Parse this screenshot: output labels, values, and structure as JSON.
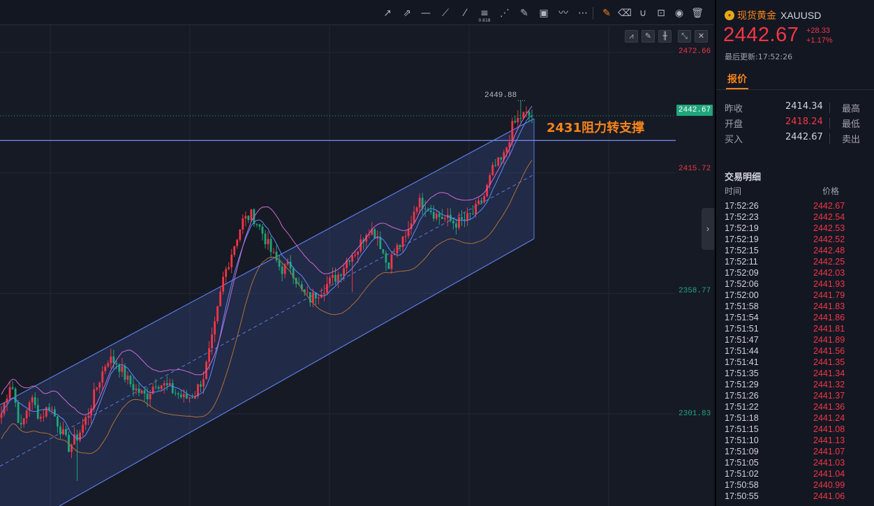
{
  "toolbar": {
    "tools": [
      "ray-icon",
      "arrow-icon",
      "horizontal-line-icon",
      "trend-line-icon",
      "extended-line-icon",
      "fib-retracement-icon",
      "fib-fan-icon",
      "brush-icon",
      "image-icon",
      "path-icon",
      "more-icon",
      "edit-active-icon",
      "eraser-icon",
      "magnet-icon",
      "lock-icon",
      "eye-icon",
      "trash-icon"
    ],
    "fib_label": "0.618"
  },
  "chart_controls": [
    "indicator-icon",
    "pencil-icon",
    "candle-type-icon",
    "fullscreen-icon",
    "close-icon"
  ],
  "price_axis": {
    "labels": [
      {
        "text": "2472.66",
        "color": "#f23645"
      },
      {
        "text": "2415.72",
        "color": "#f23645"
      },
      {
        "text": "2358.77",
        "color": "#1fa67a"
      },
      {
        "text": "2301.83",
        "color": "#1fa67a"
      }
    ],
    "current": "2442.67",
    "current_color": "#1fa67a"
  },
  "annotation": "2431阻力转支撑",
  "high_marker": "2449.88",
  "panel": {
    "symbol_name": "现货黄金",
    "symbol_code": "XAUUSD",
    "price": "2442.67",
    "change_abs": "+28.33",
    "change_pct": "+1.17%",
    "updated_label": "最后更新:17:52:26",
    "quote_tab": "报价",
    "quote_rows": [
      {
        "label": "昨收",
        "value": "2414.34",
        "value_color": "#d1d4dc",
        "label2": "最高"
      },
      {
        "label": "开盘",
        "value": "2418.24",
        "value_color": "#f23645",
        "label2": "最低"
      },
      {
        "label": "买入",
        "value": "2442.67",
        "value_color": "#d1d4dc",
        "label2": "卖出"
      }
    ],
    "trades_title": "交易明细",
    "col_time": "时间",
    "col_price": "价格",
    "trades": [
      {
        "time": "17:52:26",
        "price": "2442.67"
      },
      {
        "time": "17:52:23",
        "price": "2442.54"
      },
      {
        "time": "17:52:19",
        "price": "2442.53"
      },
      {
        "time": "17:52:19",
        "price": "2442.52"
      },
      {
        "time": "17:52:15",
        "price": "2442.48"
      },
      {
        "time": "17:52:11",
        "price": "2442.25"
      },
      {
        "time": "17:52:09",
        "price": "2442.03"
      },
      {
        "time": "17:52:06",
        "price": "2441.93"
      },
      {
        "time": "17:52:00",
        "price": "2441.79"
      },
      {
        "time": "17:51:58",
        "price": "2441.83"
      },
      {
        "time": "17:51:54",
        "price": "2441.86"
      },
      {
        "time": "17:51:51",
        "price": "2441.81"
      },
      {
        "time": "17:51:47",
        "price": "2441.89"
      },
      {
        "time": "17:51:44",
        "price": "2441.56"
      },
      {
        "time": "17:51:41",
        "price": "2441.35"
      },
      {
        "time": "17:51:35",
        "price": "2441.34"
      },
      {
        "time": "17:51:29",
        "price": "2441.32"
      },
      {
        "time": "17:51:26",
        "price": "2441.37"
      },
      {
        "time": "17:51:22",
        "price": "2441.36"
      },
      {
        "time": "17:51:18",
        "price": "2441.24"
      },
      {
        "time": "17:51:15",
        "price": "2441.08"
      },
      {
        "time": "17:51:10",
        "price": "2441.13"
      },
      {
        "time": "17:51:09",
        "price": "2441.07"
      },
      {
        "time": "17:51:05",
        "price": "2441.03"
      },
      {
        "time": "17:51:02",
        "price": "2441.04"
      },
      {
        "time": "17:50:58",
        "price": "2440.99"
      },
      {
        "time": "17:50:55",
        "price": "2441.06"
      }
    ]
  },
  "colors": {
    "up": "#f23645",
    "down": "#1fa67a",
    "accent": "#f7841a",
    "channel": "#5b7ce6"
  },
  "chart_data": {
    "type": "candlestick",
    "y_axis_ticks": [
      2472.66,
      2415.72,
      2358.77,
      2301.83
    ],
    "current_price": 2442.67,
    "marked_high": 2449.88,
    "resistance_support_level": 2431,
    "close_path": [
      2302,
      2318,
      2294,
      2310,
      2300,
      2306,
      2296,
      2286,
      2292,
      2302,
      2316,
      2328,
      2326,
      2318,
      2313,
      2310,
      2317,
      2315,
      2312,
      2309,
      2311,
      2320,
      2340,
      2366,
      2380,
      2393,
      2396,
      2388,
      2378,
      2370,
      2372,
      2360,
      2356,
      2360,
      2364,
      2368,
      2376,
      2380,
      2390,
      2386,
      2372,
      2380,
      2385,
      2402,
      2401,
      2396,
      2394,
      2392,
      2393,
      2397,
      2404,
      2418,
      2422,
      2438,
      2443,
      2442.67
    ]
  }
}
